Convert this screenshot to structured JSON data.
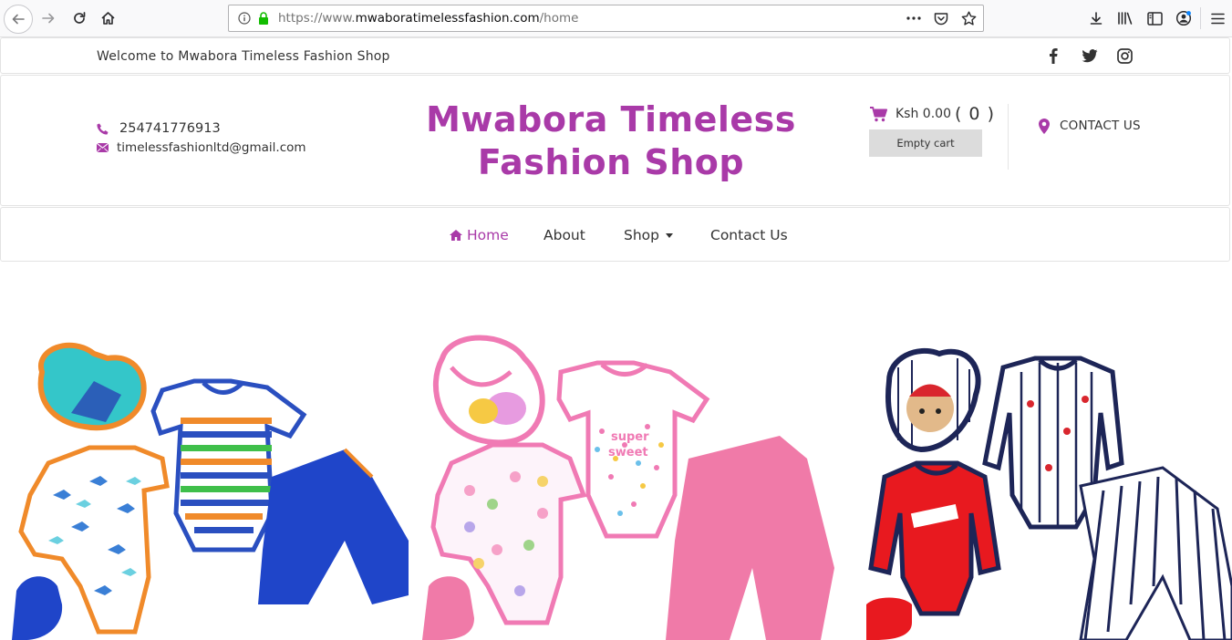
{
  "browser": {
    "url_prefix": "https://www.",
    "url_host": "mwaboratimelessfashion.com",
    "url_path": "/home",
    "icons": {
      "back": "back-arrow-icon",
      "forward": "forward-arrow-icon",
      "reload": "reload-icon",
      "home": "home-icon",
      "info": "info-icon",
      "lock": "lock-icon",
      "more": "more-dots-icon",
      "pocket": "pocket-icon",
      "bookmark": "star-icon",
      "downloads": "download-icon",
      "library": "library-icon",
      "sidebar": "sidebar-icon",
      "account": "account-icon",
      "menu": "hamburger-menu-icon"
    }
  },
  "topbar": {
    "welcome_text": "Welcome to Mwabora Timeless Fashion Shop",
    "social": [
      "facebook-icon",
      "twitter-icon",
      "instagram-icon"
    ]
  },
  "header": {
    "phone": "254741776913",
    "email": "timelessfashionltd@gmail.com",
    "title_line1": "Mwabora Timeless",
    "title_line2": "Fashion Shop",
    "cart_amount": "Ksh 0.00",
    "cart_count": "( 0 )",
    "empty_cart_label": "Empty cart",
    "contact_us_label": "CONTACT US"
  },
  "nav": {
    "items": [
      {
        "label": "Home",
        "active": true
      },
      {
        "label": "About"
      },
      {
        "label": "Shop",
        "dropdown": true
      },
      {
        "label": "Contact Us"
      }
    ]
  },
  "colors": {
    "brand_purple": "#a93aa8",
    "text": "#333333",
    "empty_cart_bg": "#dcdcdc"
  },
  "products": [
    {
      "name": "baby-set-shark-blue"
    },
    {
      "name": "baby-set-butterfly-pink"
    },
    {
      "name": "baby-set-bear-navy-red"
    }
  ]
}
